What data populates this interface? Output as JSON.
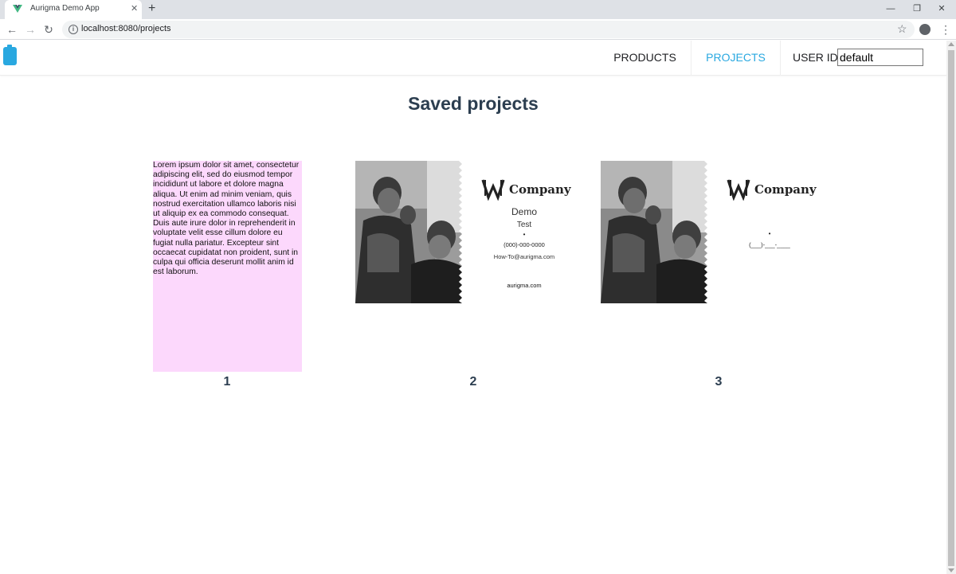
{
  "browser": {
    "tab_title": "Aurigma Demo App",
    "url": "localhost:8080/projects"
  },
  "nav": {
    "products": "PRODUCTS",
    "projects": "PROJECTS",
    "userid_label": "USER ID",
    "userid_value": "default",
    "active_color": "#29a8e0"
  },
  "page": {
    "title": "Saved projects"
  },
  "projects": [
    {
      "number": "1",
      "text": "Lorem ipsum dolor sit amet, consectetur adipiscing elit, sed do eiusmod tempor incididunt ut labore et dolore magna aliqua. Ut enim ad minim veniam, quis nostrud exercitation ullamco laboris nisi ut aliquip ex ea commodo consequat. Duis aute irure dolor in reprehenderit in voluptate velit esse cillum dolore eu fugiat nulla pariatur. Excepteur sint occaecat cupidatat non proident, sunt in culpa qui officia deserunt mollit anim id est laborum.",
      "background": "#fcd8fc"
    },
    {
      "number": "2",
      "company": "Company",
      "name": "Demo",
      "role": "Test",
      "bullet": "•",
      "phone": "(000)-000-0000",
      "email": "How-To@aurigma.com",
      "website": "aurigma.com"
    },
    {
      "number": "3",
      "company": "Company",
      "bullet": "•",
      "phone": "(___)-___-____"
    }
  ]
}
